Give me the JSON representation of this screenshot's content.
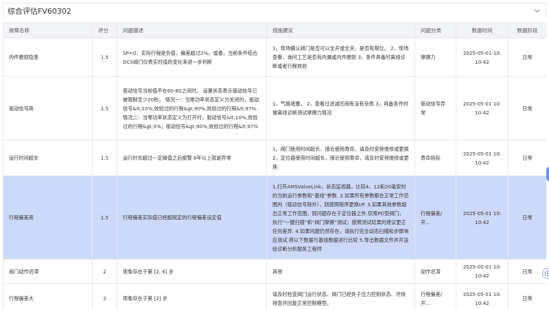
{
  "panel": {
    "title": "综合评估FV60302"
  },
  "columns": [
    "故障名称",
    "评分",
    "问题描述",
    "措施建议",
    "问题分类",
    "数据时间",
    "数据阶段"
  ],
  "rows": [
    {
      "name": "内件磨损隐患",
      "score": "1.5",
      "desc": "SP=0，实际行程是负值，偏差超过2%。或者，当前条件结合DCS阀门仪表实时值的变化来进一步判断",
      "advice": "1，现场确认阀门是否可以全开或全关，是否有限位。 2，现场查看，询问工艺是否有内漏或内件磨损 3，条件具备时离线诊断或者行程效验",
      "category": "摩擦力",
      "time": "2025-05-01 10:10:42",
      "stage": "日常"
    },
    {
      "name": "驱动信号高",
      "score": "1.5",
      "desc": "驱动信号当前值不在60-80之间时。 设置状态表示驱动信号已被限制至少20秒。 情况一：当零功率状态定义为关闭时，驱动信号&lt;10%,效验过的行程&gt;90%,效验过的行程&lt;97%. 情况二：当零功率状态定义为打开时，驱动信号&lt;10%,效验过的行程&gt;3%；驱动信号&gt;90%,效验过的行程&lt;97%",
      "advice": "1，气路堵塞， 2，查看过滤减压阀有没有杂质 3，具备条件时做离线诊断测试摩擦力情况",
      "category": "驱动信号异常",
      "time": "2025-05-01 10:10:42",
      "stage": "日常"
    },
    {
      "name": "运行时间超长",
      "score": "1.5",
      "desc": "运行时长超过一定阈值之后报警 8年以上就是异常",
      "advice": "1，阀门使用时间超长，接近使用寿命，请及时安排维修或更换 2，定位器使用时间超长，接近使用寿命，请及时安排维修或更换",
      "category": "寿命指标",
      "time": "2025-05-01 10:10:42",
      "stage": "日常"
    },
    {
      "name": "行程偏差高",
      "score": "1.5",
      "desc": "行程偏差实际值已经超规定的行程偏差设定值",
      "advice": "1.打开AMSValveLink，状态监视器，比较4、12和20毫安时的当前运行参数和“基线”参数. 2.如果所有参数都在正常工作范围内（驱动信号除外），则按照程序更换I/P. 3.如果其他参数超出正常工作范围，则问题存在于定位器之外.仅限PD型阀门，执行“一键扫描”和“阀门摩擦”测试；按照测试结果的建议更正任何差异. 4.如果问题仍然存在，请执行完全动态扫描和步骤响应测试.将以下数据与基线数据进行比较 5.导出数据文件并开送给诊断分析服务工程师",
      "category": "行程偏差/开...",
      "time": "2025-05-01 10:10:42",
      "stage": "日常",
      "highlight": true
    },
    {
      "name": "阀门动作迟滞",
      "score": "2",
      "desc": "现象存在于第 [2, 6] 步",
      "advice": "其他",
      "category": "动作迟滞",
      "time": "2025-05-01 10:10:42",
      "stage": "日常"
    },
    {
      "name": "行程偏差大",
      "score": "2",
      "desc": "现象存在于第 [2] 步",
      "advice": "请及时检查阀门运行状态、阀门已经处于压力控制状态、尽快排查并回复正常控制模型。",
      "category": "行程偏差/开...",
      "time": "2025-05-01 10:10:42",
      "stage": "日常"
    }
  ],
  "icons": {
    "collapse": "chevron-down-icon",
    "help": "help-circle-icon"
  },
  "colors": {
    "highlight_row": "#cdd9f8",
    "header_bg": "#f2f3f6",
    "accent": "#6f8fe8"
  }
}
